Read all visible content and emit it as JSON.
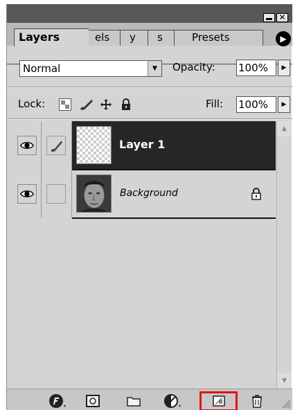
{
  "panel": {
    "tabs": [
      "Layers",
      "els",
      "y",
      "s",
      "Presets"
    ],
    "active_tab": "Layers"
  },
  "blend_mode": {
    "value": "Normal"
  },
  "opacity": {
    "label": "Opacity:",
    "value": "100%"
  },
  "lock": {
    "label": "Lock:"
  },
  "fill": {
    "label": "Fill:",
    "value": "100%"
  },
  "layers": [
    {
      "name": "Layer 1",
      "selected": true,
      "visible": true,
      "linked_brush": true,
      "thumbnail": "transparent-checker"
    },
    {
      "name": "Background",
      "selected": false,
      "visible": true,
      "locked": true,
      "thumbnail": "face-photo"
    }
  ],
  "icons": {
    "panel_menu": "right-arrow-icon",
    "lock_transparent": "checkerboard-icon",
    "lock_image": "brush-icon",
    "lock_position": "move-icon",
    "lock_all": "padlock-icon",
    "bottom": [
      "layer-style-icon",
      "layer-mask-icon",
      "layer-set-icon",
      "adjustment-layer-icon",
      "new-layer-icon",
      "trash-icon"
    ]
  },
  "colors": {
    "selection_bg": "#262626",
    "highlight": "#e01414",
    "panel_bg": "#d4d4d4"
  }
}
